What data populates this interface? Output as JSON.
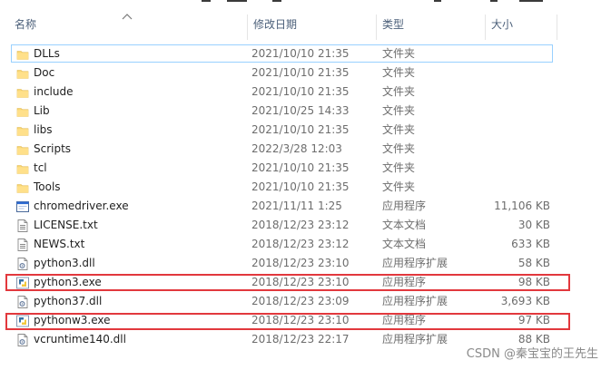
{
  "columns": {
    "name": "名称",
    "modified": "修改日期",
    "type": "类型",
    "size": "大小"
  },
  "files": [
    {
      "name": "DLLs",
      "modified": "2021/10/10 21:35",
      "type": "文件夹",
      "size": "",
      "icon": "folder-icon"
    },
    {
      "name": "Doc",
      "modified": "2021/10/10 21:35",
      "type": "文件夹",
      "size": "",
      "icon": "folder-icon"
    },
    {
      "name": "include",
      "modified": "2021/10/10 21:35",
      "type": "文件夹",
      "size": "",
      "icon": "folder-icon"
    },
    {
      "name": "Lib",
      "modified": "2021/10/25 14:33",
      "type": "文件夹",
      "size": "",
      "icon": "folder-icon"
    },
    {
      "name": "libs",
      "modified": "2021/10/10 21:35",
      "type": "文件夹",
      "size": "",
      "icon": "folder-icon"
    },
    {
      "name": "Scripts",
      "modified": "2022/3/28 12:03",
      "type": "文件夹",
      "size": "",
      "icon": "folder-icon"
    },
    {
      "name": "tcl",
      "modified": "2021/10/10 21:35",
      "type": "文件夹",
      "size": "",
      "icon": "folder-icon"
    },
    {
      "name": "Tools",
      "modified": "2021/10/10 21:35",
      "type": "文件夹",
      "size": "",
      "icon": "folder-icon"
    },
    {
      "name": "chromedriver.exe",
      "modified": "2021/11/11 1:25",
      "type": "应用程序",
      "size": "11,106 KB",
      "icon": "application-icon"
    },
    {
      "name": "LICENSE.txt",
      "modified": "2018/12/23 23:12",
      "type": "文本文档",
      "size": "30 KB",
      "icon": "text-document-icon"
    },
    {
      "name": "NEWS.txt",
      "modified": "2018/12/23 23:12",
      "type": "文本文档",
      "size": "633 KB",
      "icon": "text-document-icon"
    },
    {
      "name": "python3.dll",
      "modified": "2018/12/23 23:10",
      "type": "应用程序扩展",
      "size": "58 KB",
      "icon": "dll-icon"
    },
    {
      "name": "python3.exe",
      "modified": "2018/12/23 23:10",
      "type": "应用程序",
      "size": "98 KB",
      "icon": "python-icon"
    },
    {
      "name": "python37.dll",
      "modified": "2018/12/23 23:09",
      "type": "应用程序扩展",
      "size": "3,693 KB",
      "icon": "dll-icon"
    },
    {
      "name": "pythonw3.exe",
      "modified": "2018/12/23 23:10",
      "type": "应用程序",
      "size": "97 KB",
      "icon": "python-icon"
    },
    {
      "name": "vcruntime140.dll",
      "modified": "2018/12/23 22:17",
      "type": "应用程序扩展",
      "size": "88 KB",
      "icon": "dll-icon"
    }
  ],
  "focused_file": "DLLs",
  "highlighted_files": [
    "python3.exe",
    "pythonw3.exe"
  ],
  "highlight_color": "#e2383d",
  "watermark": "CSDN @秦宝宝的王先生"
}
